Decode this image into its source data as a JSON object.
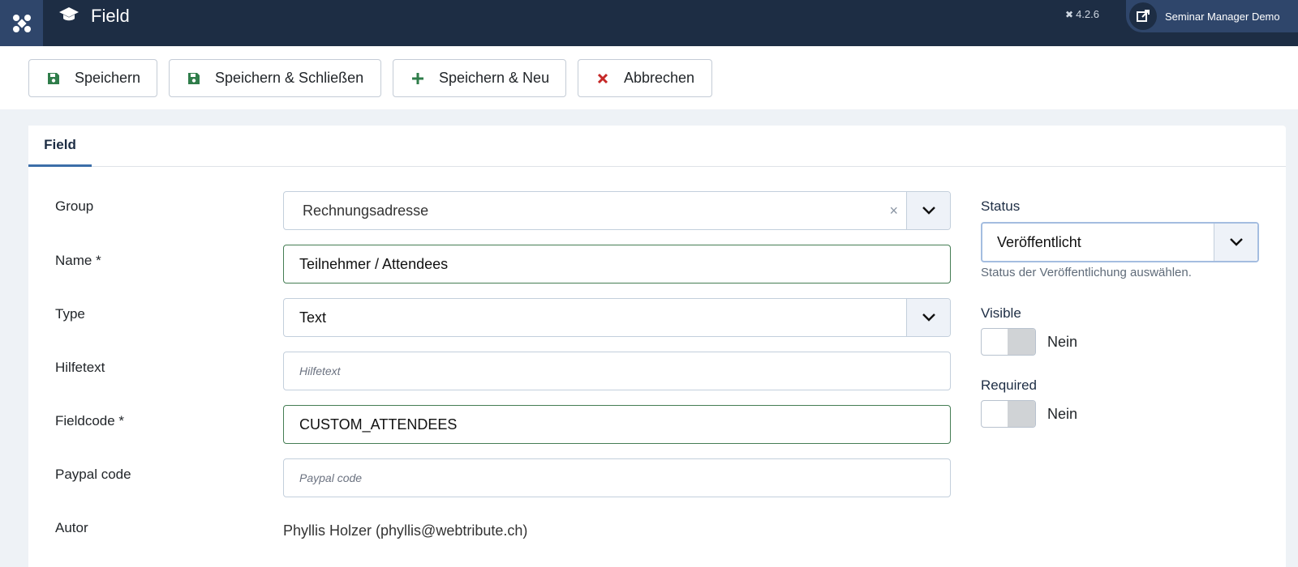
{
  "header": {
    "title": "Field",
    "version": "4.2.6",
    "site_name": "Seminar Manager Demo"
  },
  "toolbar": {
    "save": "Speichern",
    "save_close": "Speichern & Schließen",
    "save_new": "Speichern & Neu",
    "cancel": "Abbrechen"
  },
  "tabs": [
    {
      "label": "Field"
    }
  ],
  "form": {
    "group": {
      "label": "Group",
      "value": "Rechnungsadresse"
    },
    "name": {
      "label": "Name *",
      "value": "Teilnehmer / Attendees"
    },
    "type": {
      "label": "Type",
      "value": "Text"
    },
    "hilfetext": {
      "label": "Hilfetext",
      "placeholder": "Hilfetext"
    },
    "fieldcode": {
      "label": "Fieldcode *",
      "value": "CUSTOM_ATTENDEES"
    },
    "paypal": {
      "label": "Paypal code",
      "placeholder": "Paypal code"
    },
    "autor": {
      "label": "Autor",
      "value": "Phyllis Holzer (phyllis@webtribute.ch)"
    }
  },
  "sidebar": {
    "status": {
      "label": "Status",
      "value": "Veröffentlicht",
      "hint": "Status der Veröffentlichung auswählen."
    },
    "visible": {
      "label": "Visible",
      "value": "Nein"
    },
    "required": {
      "label": "Required",
      "value": "Nein"
    }
  },
  "colors": {
    "header_bg": "#1d2d44",
    "accent": "#3c6ea8",
    "save_icon": "#2f7d4a",
    "cancel_icon": "#c52827"
  }
}
